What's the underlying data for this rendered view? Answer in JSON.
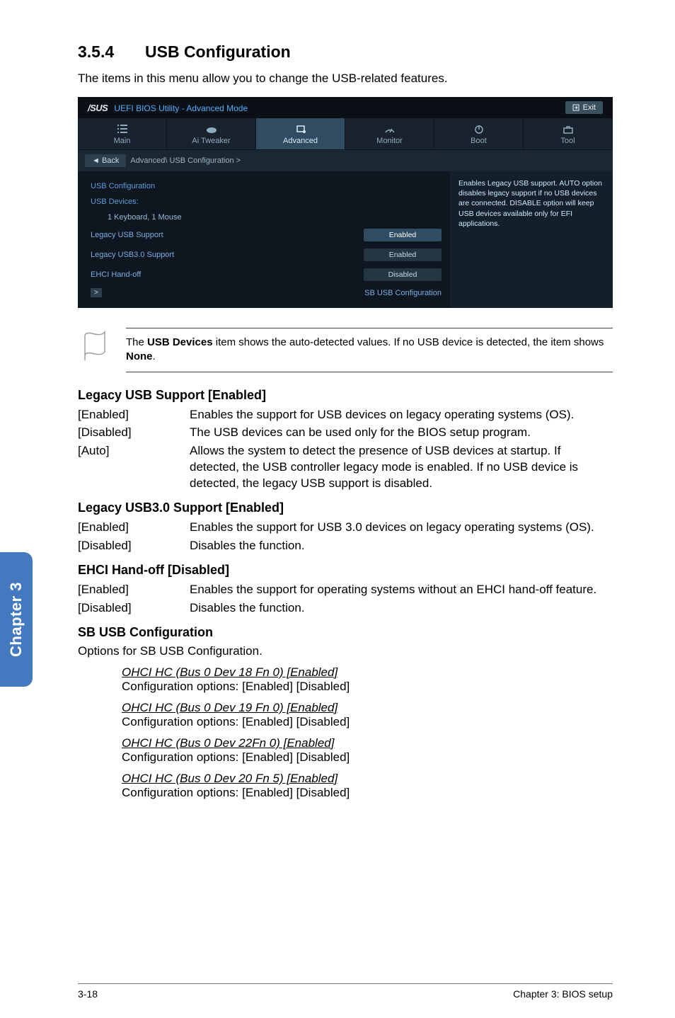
{
  "section": {
    "number": "3.5.4",
    "title": "USB Configuration"
  },
  "intro": "The items in this menu allow you to change the USB-related features.",
  "bios": {
    "brand": "/SUS",
    "title": "UEFI BIOS Utility - Advanced Mode",
    "exit": "Exit",
    "tabs": [
      "Main",
      "Ai Tweaker",
      "Advanced",
      "Monitor",
      "Boot",
      "Tool"
    ],
    "active_tab": 2,
    "breadcrumb_back": "Back",
    "breadcrumb_path": "Advanced\\ USB Configuration >",
    "left": {
      "heading": "USB Configuration",
      "devices_label": "USB Devices:",
      "devices_value": "1 Keyboard, 1 Mouse",
      "rows": [
        {
          "label": "Legacy USB Support",
          "value": "Enabled",
          "selected": true
        },
        {
          "label": "Legacy USB3.0 Support",
          "value": "Enabled",
          "selected": false
        },
        {
          "label": "EHCI Hand-off",
          "value": "Disabled",
          "selected": false
        }
      ],
      "subrow": "SB USB Configuration"
    },
    "right_help": "Enables Legacy USB support. AUTO option disables legacy support if no USB devices are connected. DISABLE option will keep USB devices available only for EFI applications."
  },
  "note": {
    "pre": "The ",
    "bold1": "USB Devices",
    "mid": " item shows the auto-detected values. If no USB device is detected, the item shows ",
    "bold2": "None",
    "post": "."
  },
  "sections": {
    "legacy_usb": {
      "title": "Legacy USB Support [Enabled]",
      "opts": [
        {
          "k": "[Enabled]",
          "v": "Enables the support for USB devices on legacy operating systems (OS)."
        },
        {
          "k": "[Disabled]",
          "v": "The USB devices can be used only for the BIOS setup program."
        },
        {
          "k": "[Auto]",
          "v": "Allows the system to detect the presence of USB devices at startup. If detected, the USB controller legacy mode is enabled. If no USB device is detected, the legacy USB support is disabled."
        }
      ]
    },
    "legacy_usb30": {
      "title": "Legacy USB3.0 Support [Enabled]",
      "opts": [
        {
          "k": "[Enabled]",
          "v": "Enables the support for USB 3.0 devices on legacy operating systems (OS)."
        },
        {
          "k": "[Disabled]",
          "v": "Disables the function."
        }
      ]
    },
    "ehci": {
      "title": "EHCI Hand-off [Disabled]",
      "opts": [
        {
          "k": "[Enabled]",
          "v": "Enables the support for operating systems without an EHCI hand-off feature."
        },
        {
          "k": "[Disabled]",
          "v": "Disables the function."
        }
      ]
    },
    "sbusb": {
      "title": "SB USB Configuration",
      "desc": "Options for SB USB Configuration.",
      "items": [
        {
          "head": "OHCI HC (Bus 0 Dev 18 Fn 0) [Enabled]",
          "conf": "Configuration options: [Enabled] [Disabled]"
        },
        {
          "head": "OHCI HC (Bus 0 Dev 19 Fn 0) [Enabled]",
          "conf": "Configuration options: [Enabled] [Disabled]"
        },
        {
          "head": "OHCI HC (Bus 0 Dev 22Fn 0) [Enabled]",
          "conf": "Configuration options: [Enabled] [Disabled]"
        },
        {
          "head": "OHCI HC (Bus 0 Dev 20 Fn 5) [Enabled]",
          "conf": "Configuration options: [Enabled] [Disabled]"
        }
      ]
    }
  },
  "sidetab": "Chapter 3",
  "footer": {
    "left": "3-18",
    "right": "Chapter 3: BIOS setup"
  }
}
